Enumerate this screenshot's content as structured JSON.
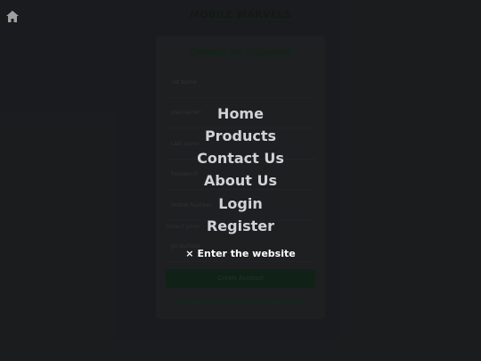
{
  "header": {
    "brand": "MOBILE MARVELS",
    "home_icon": "home-icon"
  },
  "signup": {
    "title": "Create an Account",
    "fields": [
      {
        "placeholder": "1st Name"
      },
      {
        "placeholder": "Username*"
      },
      {
        "placeholder": "Last name"
      },
      {
        "placeholder": "Password*"
      },
      {
        "placeholder": "Mobile Number"
      }
    ],
    "select_label": "Select your ",
    "last_field": {
      "placeholder": "Joi Number"
    },
    "submit_label": "Create Account",
    "login_prompt": "Already have an account? Login here"
  },
  "overlay_menu": {
    "items": [
      "Home",
      "Products",
      "Contact Us",
      "About Us",
      "Login",
      "Register"
    ],
    "close_icon": "×",
    "enter_label": "Enter the website"
  }
}
